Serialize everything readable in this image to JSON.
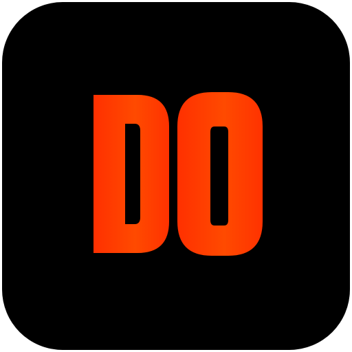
{
  "icon": {
    "logo_text": "DO",
    "background_color": "#000000",
    "gradient_start_color": "#ff3000",
    "gradient_mid_color": "#ff4a00",
    "gradient_end_color": "#ff3200"
  }
}
